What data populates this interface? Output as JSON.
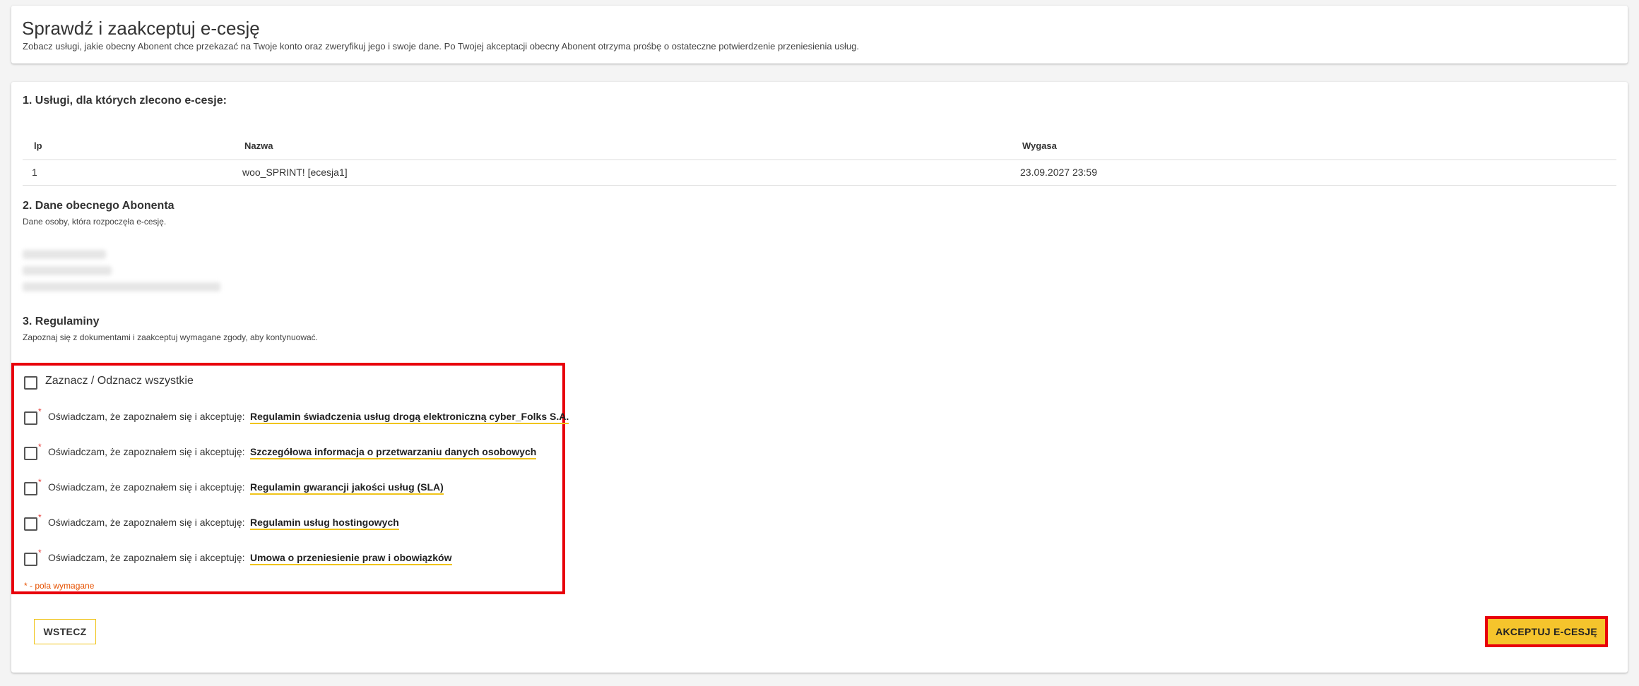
{
  "header": {
    "title": "Sprawdź i zaakceptuj e-cesję",
    "subtitle": "Zobacz usługi, jakie obecny Abonent chce przekazać na Twoje konto oraz zweryfikuj jego i swoje dane. Po Twojej akceptacji obecny Abonent otrzyma prośbę o ostateczne potwierdzenie przeniesienia usług."
  },
  "services": {
    "title": "1. Usługi, dla których zlecono e-cesje:",
    "columns": [
      "lp",
      "Nazwa",
      "Wygasa"
    ],
    "rows": [
      {
        "lp": "1",
        "name": "woo_SPRINT! [ecesja1]",
        "expires": "23.09.2027 23:59"
      }
    ]
  },
  "current_subscriber": {
    "title": "2. Dane obecnego Abonenta",
    "subtitle": "Dane osoby, która rozpoczęła e-cesję."
  },
  "terms": {
    "title": "3. Regulaminy",
    "subtitle": "Zapoznaj się z dokumentami i zaakceptuj wymagane zgody, aby kontynuować.",
    "select_all_label": "Zaznacz / Odznacz wszystkie",
    "statement_prefix": "Oświadczam, że zapoznałem się i akceptuję:",
    "items": [
      {
        "link": "Regulamin świadczenia usług drogą elektroniczną cyber_Folks S.A.",
        "required": "*"
      },
      {
        "link": "Szczegółowa informacja o przetwarzaniu danych osobowych",
        "required": "*"
      },
      {
        "link": "Regulamin gwarancji jakości usług (SLA)",
        "required": "*"
      },
      {
        "link": "Regulamin usług hostingowych",
        "required": "*"
      },
      {
        "link": "Umowa o przeniesienie praw i obowiązków",
        "required": "*"
      }
    ],
    "required_note": "* - pola wymagane"
  },
  "actions": {
    "back_label": "WSTECZ",
    "accept_label": "AKCEPTUJ E-CESJĘ"
  },
  "colors": {
    "accent": "#f5c42c",
    "highlight": "#e8000b",
    "required": "#e53935"
  }
}
